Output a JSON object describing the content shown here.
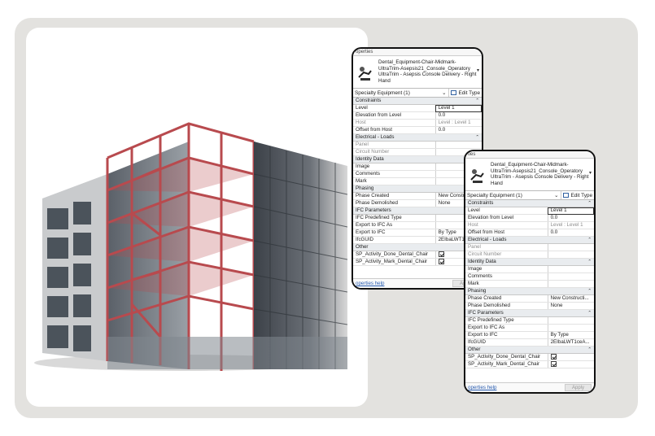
{
  "panel_back": {
    "window_title": "operties",
    "family_name": "Dental_Equipment-Chair-Midmark-UltraTrim-Asepsis21_Console_Operatory",
    "type_name": "UltraTrim - Asepsis Console Delivery - Right Hand",
    "type_selector": "Specialty Equipment (1)",
    "edit_type": "Edit Type",
    "help_link": "operties help",
    "apply_label": "Apply",
    "rows": [
      {
        "section": "Constraints"
      },
      {
        "k": "Level",
        "v": "Level 1",
        "box": true
      },
      {
        "k": "Elevation from Level",
        "v": "0.0"
      },
      {
        "k": "Host",
        "v": "Level : Level 1",
        "dim": true
      },
      {
        "k": "Offset from Host",
        "v": "0.0"
      },
      {
        "section": "Electrical - Loads"
      },
      {
        "k": "Panel",
        "v": "",
        "dim": true
      },
      {
        "k": "Circuit Number",
        "v": "",
        "dim": true
      },
      {
        "section": "Identity Data"
      },
      {
        "k": "Image",
        "v": ""
      },
      {
        "k": "Comments",
        "v": ""
      },
      {
        "k": "Mark",
        "v": ""
      },
      {
        "section": "Phasing"
      },
      {
        "k": "Phase Created",
        "v": "New Constr"
      },
      {
        "k": "Phase Demolished",
        "v": "None"
      },
      {
        "section": "IFC Parameters"
      },
      {
        "k": "IFC Predefined Type",
        "v": ""
      },
      {
        "k": "Export to IFC As",
        "v": ""
      },
      {
        "k": "Export to IFC",
        "v": "By Type"
      },
      {
        "k": "IfcGUID",
        "v": "2EIbaLWT1"
      },
      {
        "section": "Other"
      },
      {
        "k": "SP_Activity_Done_Dental_Chair",
        "check": true
      },
      {
        "k": "SP_Activity_Mark_Dental_Chair",
        "check": true
      }
    ]
  },
  "panel_front": {
    "window_title": "ties",
    "family_name": "Dental_Equipment-Chair-Midmark-UltraTrim-Asepsis21_Console_Operatory",
    "type_name": "UltraTrim - Asepsis Console Delivery - Right Hand",
    "type_selector": "Specialty Equipment (1)",
    "edit_type": "Edit Type",
    "help_link": "operties help",
    "apply_label": "Apply",
    "rows": [
      {
        "section": "Constraints"
      },
      {
        "k": "Level",
        "v": "Level 1",
        "box": true
      },
      {
        "k": "Elevation from Level",
        "v": "0.0"
      },
      {
        "k": "Host",
        "v": "Level : Level 1",
        "dim": true
      },
      {
        "k": "Offset from Host",
        "v": "0.0"
      },
      {
        "section": "Electrical - Loads"
      },
      {
        "k": "Panel",
        "v": "",
        "dim": true
      },
      {
        "k": "Circuit Number",
        "v": "",
        "dim": true
      },
      {
        "section": "Identity Data"
      },
      {
        "k": "Image",
        "v": ""
      },
      {
        "k": "Comments",
        "v": ""
      },
      {
        "k": "Mark",
        "v": ""
      },
      {
        "section": "Phasing"
      },
      {
        "k": "Phase Created",
        "v": "New Constructi..."
      },
      {
        "k": "Phase Demolished",
        "v": "None"
      },
      {
        "section": "IFC Parameters"
      },
      {
        "k": "IFC Predefined Type",
        "v": ""
      },
      {
        "k": "Export to IFC As",
        "v": ""
      },
      {
        "k": "Export to IFC",
        "v": "By Type"
      },
      {
        "k": "IfcGUID",
        "v": "2EIbaLWT1ceA..."
      },
      {
        "section": "Other"
      },
      {
        "k": "SP_Activity_Done_Dental_Chair",
        "check": true
      },
      {
        "k": "SP_Activity_Mark_Dental_Chair",
        "check": true
      }
    ]
  },
  "colors": {
    "frame": "#e3e2df",
    "steel": "#b84a4e",
    "section_bg": "#e9ecef",
    "link": "#2a5db0"
  },
  "icons": {
    "chair": "dental-chair-icon",
    "edit": "edit-type-icon",
    "dropdown": "chevron-down-icon",
    "collapse": "collapse-arrow-icon",
    "checkbox": "checkbox-checked-icon"
  }
}
